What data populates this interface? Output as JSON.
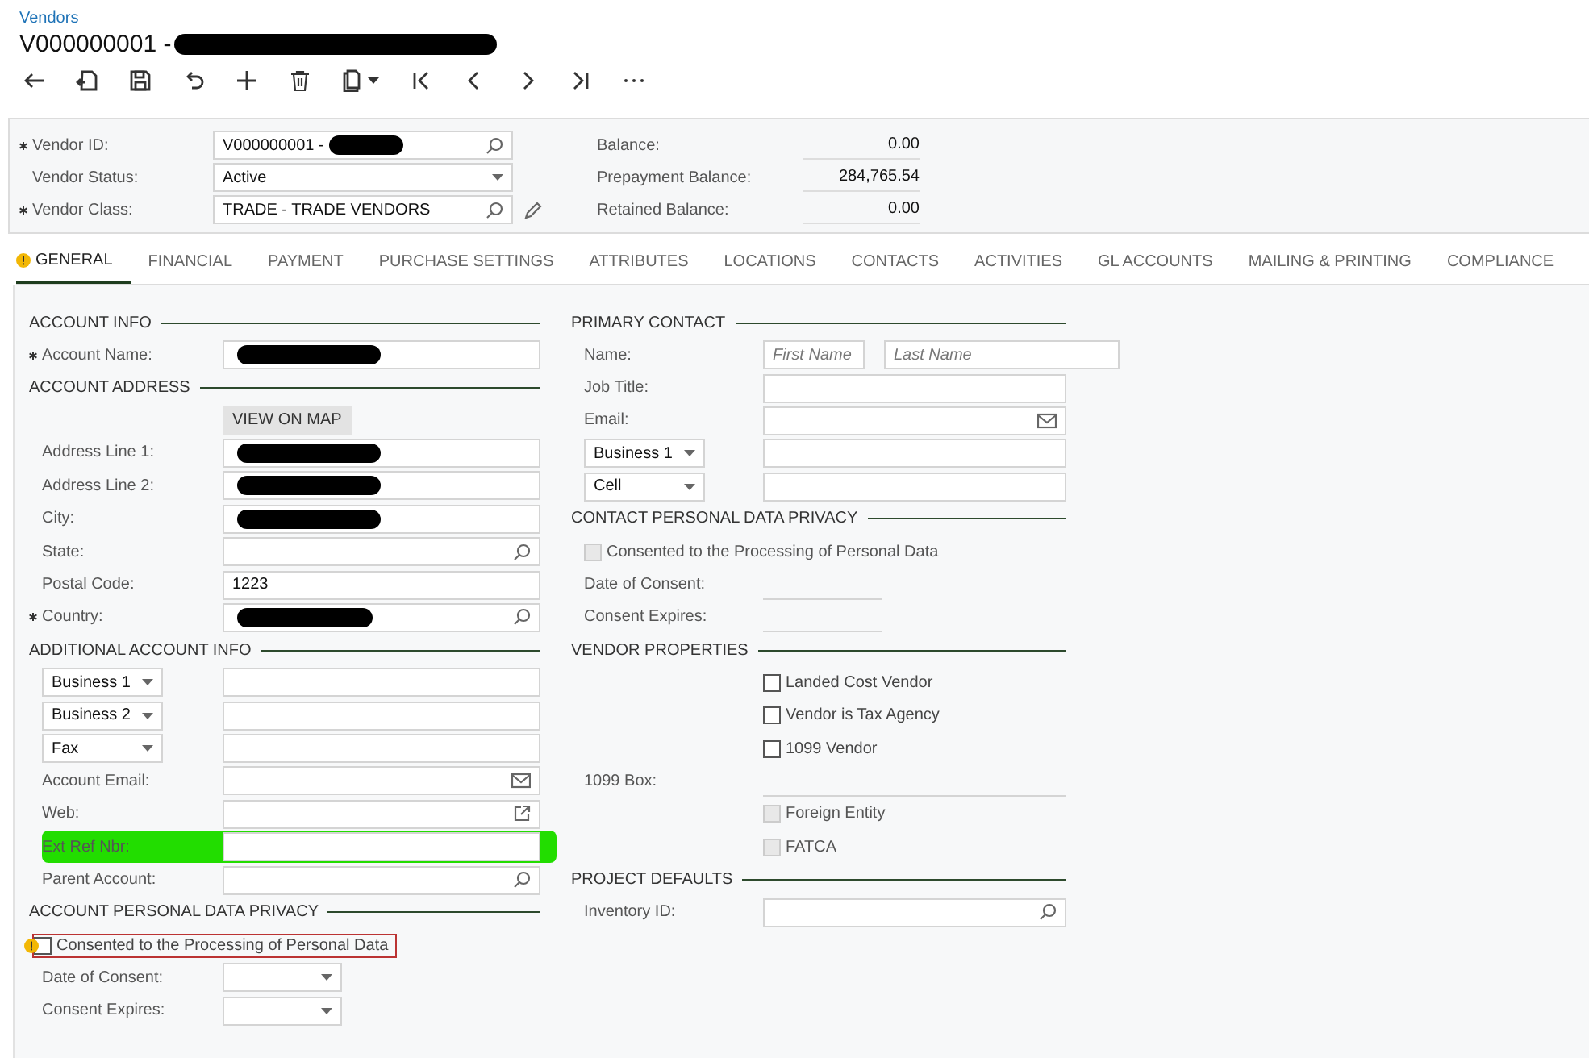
{
  "breadcrumb": "Vendors",
  "title": {
    "text": "V000000001 -",
    "redacted": true
  },
  "summary": {
    "left": [
      {
        "kind": "lookup",
        "label": "Vendor ID:",
        "required": true,
        "value": "V000000001 -",
        "redacted": true,
        "editable": false
      },
      {
        "kind": "select",
        "label": "Vendor Status:",
        "required": false,
        "value": "Active",
        "redacted": false,
        "editable": false
      },
      {
        "kind": "lookup",
        "label": "Vendor Class:",
        "required": true,
        "value": "TRADE - TRADE VENDORS",
        "redacted": false,
        "editable": true
      }
    ],
    "right": [
      {
        "label": "Balance:",
        "value": "0.00"
      },
      {
        "label": "Prepayment Balance:",
        "value": "284,765.54"
      },
      {
        "label": "Retained Balance:",
        "value": "0.00"
      }
    ]
  },
  "tabs": [
    {
      "label": "GENERAL",
      "selected": true,
      "warning": true
    },
    {
      "label": "FINANCIAL",
      "selected": false,
      "warning": false
    },
    {
      "label": "PAYMENT",
      "selected": false,
      "warning": false
    },
    {
      "label": "PURCHASE SETTINGS",
      "selected": false,
      "warning": false
    },
    {
      "label": "ATTRIBUTES",
      "selected": false,
      "warning": false
    },
    {
      "label": "LOCATIONS",
      "selected": false,
      "warning": false
    },
    {
      "label": "CONTACTS",
      "selected": false,
      "warning": false
    },
    {
      "label": "ACTIVITIES",
      "selected": false,
      "warning": false
    },
    {
      "label": "GL ACCOUNTS",
      "selected": false,
      "warning": false
    },
    {
      "label": "MAILING & PRINTING",
      "selected": false,
      "warning": false
    },
    {
      "label": "COMPLIANCE",
      "selected": false,
      "warning": false
    }
  ],
  "columns": [
    [
      {
        "title": "ACCOUNT INFO",
        "rows": [
          {
            "kind": "field",
            "label": "Account Name:",
            "required": true,
            "redacted": true,
            "highlighted": false
          }
        ]
      },
      {
        "title": "ACCOUNT ADDRESS",
        "rows": [
          {
            "kind": "button",
            "label": "VIEW ON MAP"
          },
          {
            "kind": "field",
            "label": "Address Line 1:",
            "required": false,
            "redacted": true,
            "highlighted": false
          },
          {
            "kind": "field",
            "label": "Address Line 2:",
            "required": false,
            "redacted": true,
            "highlighted": false
          },
          {
            "kind": "field",
            "label": "City:",
            "required": false,
            "redacted": true,
            "highlighted": false
          },
          {
            "kind": "lookup",
            "label": "State:",
            "required": false,
            "redacted": false,
            "highlighted": false
          },
          {
            "kind": "field",
            "label": "Postal Code:",
            "required": false,
            "value": "1223",
            "redacted": false,
            "highlighted": false
          },
          {
            "kind": "lookup",
            "label": "Country:",
            "required": true,
            "redacted": true,
            "highlighted": false
          }
        ]
      },
      {
        "title": "ADDITIONAL ACCOUNT INFO",
        "rows": [
          {
            "kind": "phone",
            "type": "Business 1"
          },
          {
            "kind": "phone",
            "type": "Business 2"
          },
          {
            "kind": "phone",
            "type": "Fax"
          },
          {
            "kind": "email",
            "label": "Account Email:",
            "required": false,
            "redacted": false,
            "highlighted": false
          },
          {
            "kind": "url",
            "label": "Web:",
            "required": false,
            "redacted": false,
            "highlighted": false
          },
          {
            "kind": "field",
            "label": "Ext Ref Nbr:",
            "required": false,
            "redacted": false,
            "highlighted": true
          },
          {
            "kind": "lookup",
            "label": "Parent Account:",
            "required": false,
            "redacted": false,
            "highlighted": false
          }
        ]
      },
      {
        "title": "ACCOUNT PERSONAL DATA PRIVACY",
        "rows": [
          {
            "kind": "optin",
            "label": "Consented to the Processing of Personal Data",
            "checked": false,
            "disabled": false,
            "error": true
          },
          {
            "kind": "date",
            "label": "Date of Consent:"
          },
          {
            "kind": "date",
            "label": "Consent Expires:"
          }
        ]
      }
    ],
    [
      {
        "title": "PRIMARY CONTACT",
        "rows": [
          {
            "kind": "name",
            "label": "Name:",
            "fields": [
              {
                "placeholder": "First Name"
              },
              {
                "placeholder": "Last Name"
              }
            ]
          },
          {
            "kind": "field",
            "label": "Job Title:",
            "required": false,
            "redacted": false,
            "highlighted": false
          },
          {
            "kind": "email",
            "label": "Email:",
            "required": false,
            "redacted": false,
            "highlighted": false
          },
          {
            "kind": "phone",
            "type": "Business 1"
          },
          {
            "kind": "phone",
            "type": "Cell"
          }
        ]
      },
      {
        "title": "CONTACT PERSONAL DATA PRIVACY",
        "rows": [
          {
            "kind": "optin",
            "label": "Consented to the Processing of Personal Data",
            "checked": false,
            "disabled": true,
            "error": false
          },
          {
            "kind": "datedisplay",
            "label": "Date of Consent:"
          },
          {
            "kind": "datedisplay",
            "label": "Consent Expires:"
          }
        ]
      },
      {
        "title": "VENDOR PROPERTIES",
        "rows": [
          {
            "kind": "checkbox",
            "label": "Landed Cost Vendor",
            "checked": false,
            "disabled": false
          },
          {
            "kind": "checkbox",
            "label": "Vendor is Tax Agency",
            "checked": false,
            "disabled": false
          },
          {
            "kind": "checkbox",
            "label": "1099 Vendor",
            "checked": false,
            "disabled": false
          },
          {
            "kind": "display",
            "label": "1099 Box:"
          },
          {
            "kind": "checkbox",
            "label": "Foreign Entity",
            "checked": false,
            "disabled": true
          },
          {
            "kind": "checkbox",
            "label": "FATCA",
            "checked": false,
            "disabled": true
          }
        ]
      },
      {
        "title": "PROJECT DEFAULTS",
        "rows": [
          {
            "kind": "lookup",
            "label": "Inventory ID:",
            "required": false,
            "redacted": false,
            "highlighted": false
          }
        ]
      }
    ]
  ]
}
